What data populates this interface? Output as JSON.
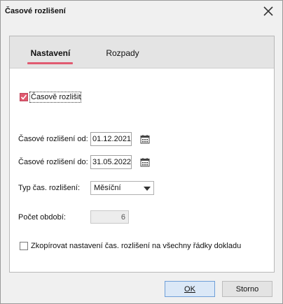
{
  "window": {
    "title": "Časové rozlišení"
  },
  "tabs": [
    {
      "label": "Nastavení",
      "active": true
    },
    {
      "label": "Rozpady",
      "active": false
    }
  ],
  "form": {
    "enable_checkbox": {
      "label": "Časově rozlišit",
      "checked": true
    },
    "date_from": {
      "label": "Časové rozlišení od:",
      "value": "01.12.2021"
    },
    "date_to": {
      "label": "Časové rozlišení do:",
      "value": "31.05.2022"
    },
    "type": {
      "label": "Typ čas. rozlišení:",
      "value": "Měsíční"
    },
    "periods": {
      "label": "Počet období:",
      "value": "6"
    },
    "copy_checkbox": {
      "label": "Zkopírovat nastavení čas. rozlišení na všechny řádky dokladu",
      "checked": false
    }
  },
  "buttons": {
    "ok": "OK",
    "cancel": "Storno"
  },
  "colors": {
    "accent": "#e05a70",
    "ok_button_bg": "#dbe8f7",
    "ok_button_border": "#6f9fd8"
  }
}
